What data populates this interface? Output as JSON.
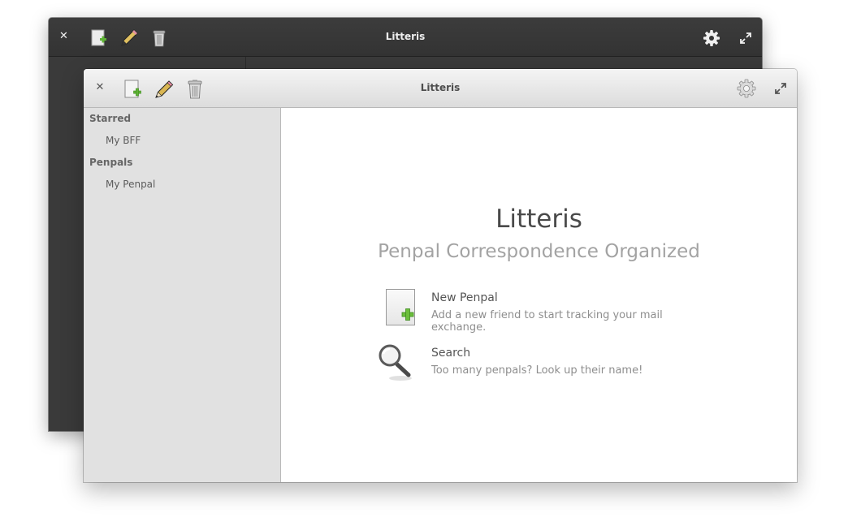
{
  "back_window": {
    "title": "Litteris",
    "close_glyph": "✕"
  },
  "window": {
    "title": "Litteris",
    "close_glyph": "✕",
    "toolbar": {
      "icons": [
        "new-document-icon",
        "edit-pencil-icon",
        "trash-icon"
      ],
      "right_icons": [
        "gear-icon",
        "maximize-icon"
      ]
    }
  },
  "sidebar": {
    "sections": [
      {
        "label": "Starred",
        "items": [
          {
            "label": "My BFF"
          }
        ]
      },
      {
        "label": "Penpals",
        "items": [
          {
            "label": "My Penpal"
          }
        ]
      }
    ]
  },
  "welcome": {
    "title": "Litteris",
    "subtitle": "Penpal Correspondence Organized",
    "actions": [
      {
        "title": "New Penpal",
        "description": "Add a new friend to start tracking your mail exchange.",
        "icon": "new-document-icon"
      },
      {
        "title": "Search",
        "description": "Too many penpals? Look up their name!",
        "icon": "magnifier-icon"
      }
    ]
  },
  "colors": {
    "accent_green": "#5fb336",
    "headerbar_light": "#e8e8e8",
    "headerbar_dark": "#363636",
    "sidebar_bg": "#e1e1e1"
  }
}
